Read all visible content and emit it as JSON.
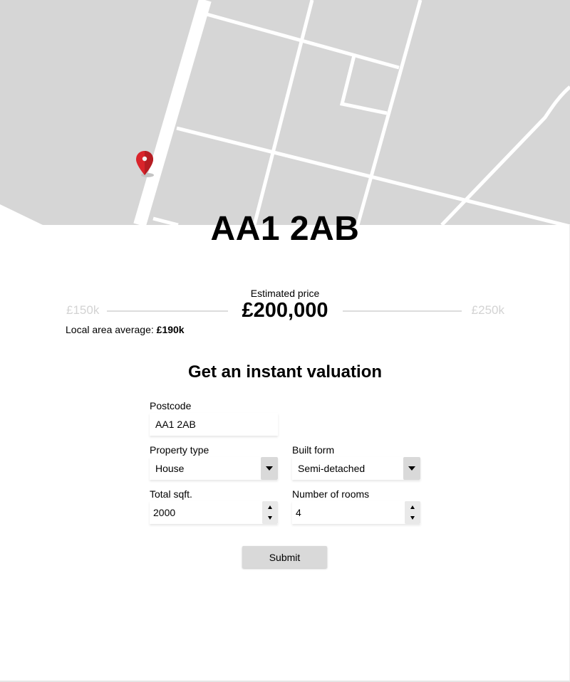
{
  "map": {
    "marker_icon": "map-pin-icon",
    "colors": {
      "land": "#d6d6d6",
      "road": "#ffffff",
      "marker": "#d9242b"
    }
  },
  "header": {
    "postcode": "AA1 2AB"
  },
  "price": {
    "estimate_label": "Estimated price",
    "estimate_value": "£200,000",
    "range_low": "£150k",
    "range_high": "£250k",
    "local_average_label": "Local area average:",
    "local_average_value": "£190k"
  },
  "form": {
    "title": "Get an instant valuation",
    "postcode": {
      "label": "Postcode",
      "value": "AA1 2AB"
    },
    "property_type": {
      "label": "Property type",
      "value": "House"
    },
    "built_form": {
      "label": "Built form",
      "value": "Semi-detached"
    },
    "total_sqft": {
      "label": "Total sqft.",
      "value": "2000"
    },
    "rooms": {
      "label": "Number of rooms",
      "value": "4"
    },
    "submit_label": "Submit"
  }
}
